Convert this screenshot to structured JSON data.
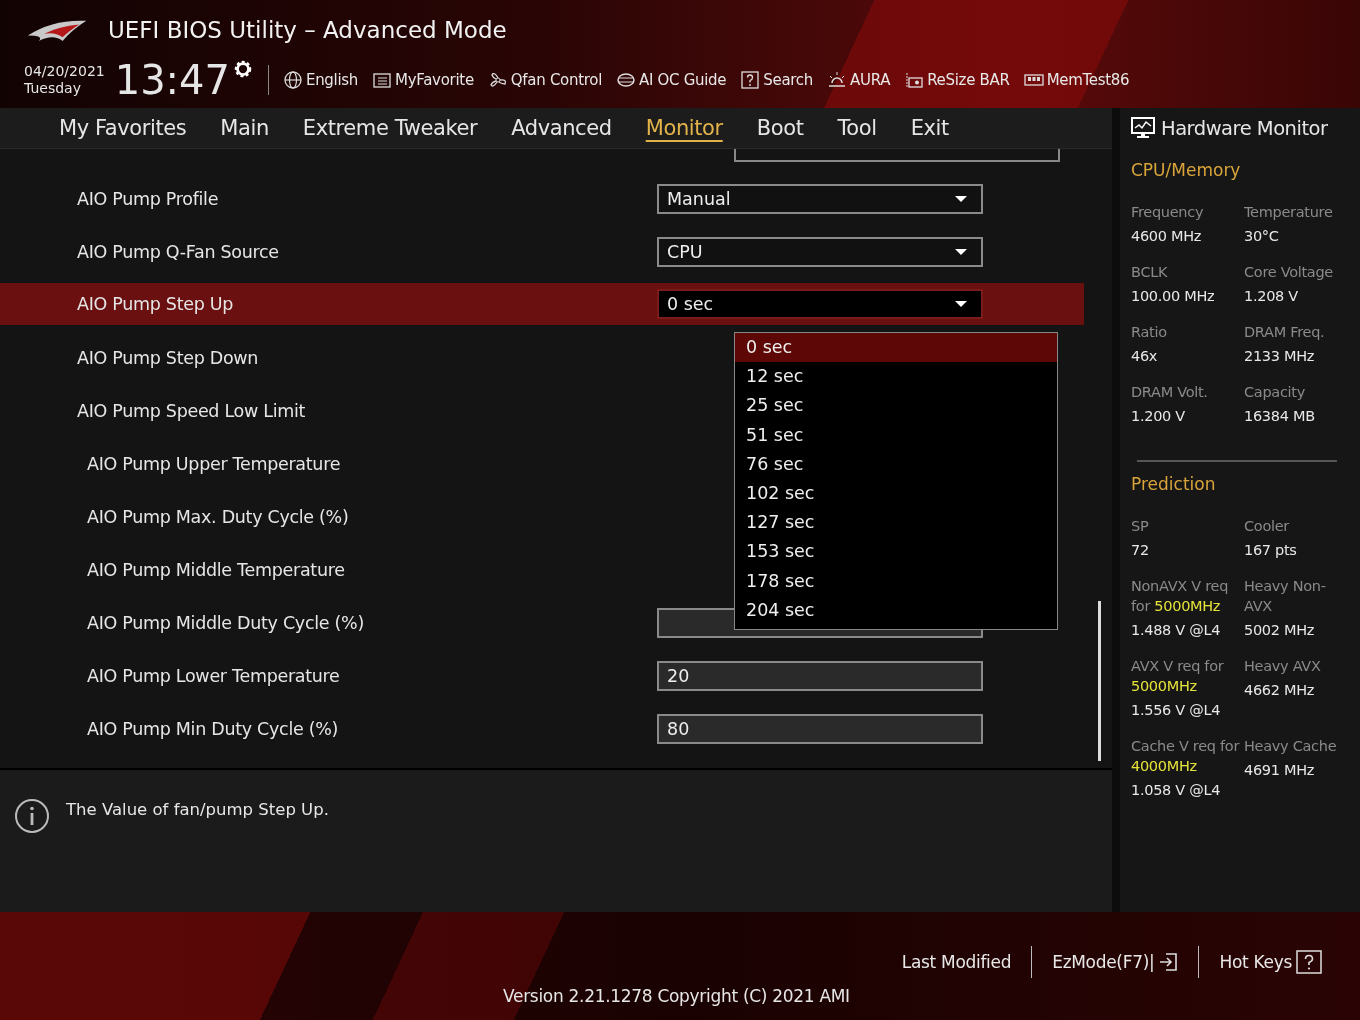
{
  "header": {
    "title": "UEFI BIOS Utility – Advanced Mode",
    "date": "04/20/2021",
    "day": "Tuesday",
    "time": "13:47",
    "tools": [
      {
        "kind": "globe",
        "label": "English"
      },
      {
        "kind": "favorite",
        "label": "MyFavorite"
      },
      {
        "kind": "fan",
        "label": "Qfan Control"
      },
      {
        "kind": "chip",
        "label": "AI OC Guide"
      },
      {
        "kind": "search",
        "label": "Search"
      },
      {
        "kind": "light",
        "label": "AURA"
      },
      {
        "kind": "card",
        "label": "ReSize BAR"
      },
      {
        "kind": "memory",
        "label": "MemTest86"
      }
    ]
  },
  "tabs": [
    {
      "label": "My Favorites",
      "selected": false
    },
    {
      "label": "Main",
      "selected": false
    },
    {
      "label": "Extreme Tweaker",
      "selected": false
    },
    {
      "label": "Advanced",
      "selected": false
    },
    {
      "label": "Monitor",
      "selected": true
    },
    {
      "label": "Boot",
      "selected": false
    },
    {
      "label": "Tool",
      "selected": false
    },
    {
      "label": "Exit",
      "selected": false
    }
  ],
  "settings": [
    {
      "label": "AIO Pump Profile",
      "kind": "dropdown",
      "value": "Manual",
      "sub": false,
      "selected": false
    },
    {
      "label": "AIO Pump Q-Fan Source",
      "kind": "dropdown",
      "value": "CPU",
      "sub": false,
      "selected": false
    },
    {
      "label": "AIO Pump Step Up",
      "kind": "dropdown",
      "value": "0 sec",
      "sub": false,
      "selected": true
    },
    {
      "label": "AIO Pump Step Down",
      "kind": "hidden",
      "sub": false,
      "selected": false
    },
    {
      "label": "AIO Pump Speed Low Limit",
      "kind": "hidden",
      "sub": false,
      "selected": false
    },
    {
      "label": "AIO Pump Upper Temperature",
      "kind": "hidden",
      "sub": true,
      "selected": false
    },
    {
      "label": "AIO Pump Max. Duty Cycle (%)",
      "kind": "hidden",
      "sub": true,
      "selected": false
    },
    {
      "label": "AIO Pump Middle Temperature",
      "kind": "hidden",
      "sub": true,
      "selected": false
    },
    {
      "label": "AIO Pump Middle Duty Cycle (%)",
      "kind": "number",
      "sub": true,
      "selected": false
    },
    {
      "label": "AIO Pump Lower Temperature",
      "kind": "number",
      "value": "20",
      "sub": true,
      "selected": false
    },
    {
      "label": "AIO Pump Min Duty Cycle (%)",
      "kind": "number",
      "value": "80",
      "sub": true,
      "selected": false
    }
  ],
  "dropdown_options": [
    {
      "label": "0 sec",
      "selected": true
    },
    {
      "label": "12 sec",
      "selected": false
    },
    {
      "label": "25 sec",
      "selected": false
    },
    {
      "label": "51 sec",
      "selected": false
    },
    {
      "label": "76 sec",
      "selected": false
    },
    {
      "label": "102 sec",
      "selected": false
    },
    {
      "label": "127 sec",
      "selected": false
    },
    {
      "label": "153 sec",
      "selected": false
    },
    {
      "label": "178 sec",
      "selected": false
    },
    {
      "label": "204 sec",
      "selected": false
    }
  ],
  "help": {
    "text": "The Value of fan/pump Step Up."
  },
  "hardware_monitor": {
    "title": "Hardware Monitor",
    "sections": [
      {
        "title": "CPU/Memory",
        "items": [
          {
            "label": [
              {
                "text": "Frequency",
                "highlight": false
              }
            ],
            "value": "4600 MHz"
          },
          {
            "label": [
              {
                "text": "Temperature",
                "highlight": false
              }
            ],
            "value": "30°C"
          },
          {
            "label": [
              {
                "text": "BCLK",
                "highlight": false
              }
            ],
            "value": "100.00 MHz"
          },
          {
            "label": [
              {
                "text": "Core Voltage",
                "highlight": false
              }
            ],
            "value": "1.208 V"
          },
          {
            "label": [
              {
                "text": "Ratio",
                "highlight": false
              }
            ],
            "value": "46x"
          },
          {
            "label": [
              {
                "text": "DRAM Freq.",
                "highlight": false
              }
            ],
            "value": "2133 MHz"
          },
          {
            "label": [
              {
                "text": "DRAM Volt.",
                "highlight": false
              }
            ],
            "value": "1.200 V"
          },
          {
            "label": [
              {
                "text": "Capacity",
                "highlight": false
              }
            ],
            "value": "16384 MB"
          }
        ]
      },
      {
        "title": "Prediction",
        "items": [
          {
            "label": [
              {
                "text": "SP",
                "highlight": false
              }
            ],
            "value": "72"
          },
          {
            "label": [
              {
                "text": "Cooler",
                "highlight": false
              }
            ],
            "value": "167 pts"
          },
          {
            "label": [
              {
                "text": "NonAVX V req for ",
                "highlight": false
              },
              {
                "text": "5000MHz",
                "highlight": true
              }
            ],
            "value": "1.488 V @L4"
          },
          {
            "label": [
              {
                "text": "Heavy Non-AVX",
                "highlight": false
              }
            ],
            "value": "5002 MHz"
          },
          {
            "label": [
              {
                "text": "AVX V req for ",
                "highlight": false
              },
              {
                "text": "5000MHz",
                "highlight": true
              }
            ],
            "value": "1.556 V @L4"
          },
          {
            "label": [
              {
                "text": "Heavy AVX",
                "highlight": false
              }
            ],
            "value": "4662 MHz"
          },
          {
            "label": [
              {
                "text": "Cache V req for ",
                "highlight": false
              },
              {
                "text": "4000MHz",
                "highlight": true
              }
            ],
            "value": "1.058 V @L4"
          },
          {
            "label": [
              {
                "text": "Heavy Cache",
                "highlight": false
              }
            ],
            "value": "4691 MHz"
          }
        ]
      }
    ]
  },
  "footer": {
    "links": [
      {
        "kind": "text",
        "label": "Last Modified"
      },
      {
        "kind": "exit",
        "label": "EzMode(F7)|"
      },
      {
        "kind": "help",
        "label": "Hot Keys"
      }
    ],
    "version": "Version 2.21.1278 Copyright (C) 2021 AMI"
  }
}
